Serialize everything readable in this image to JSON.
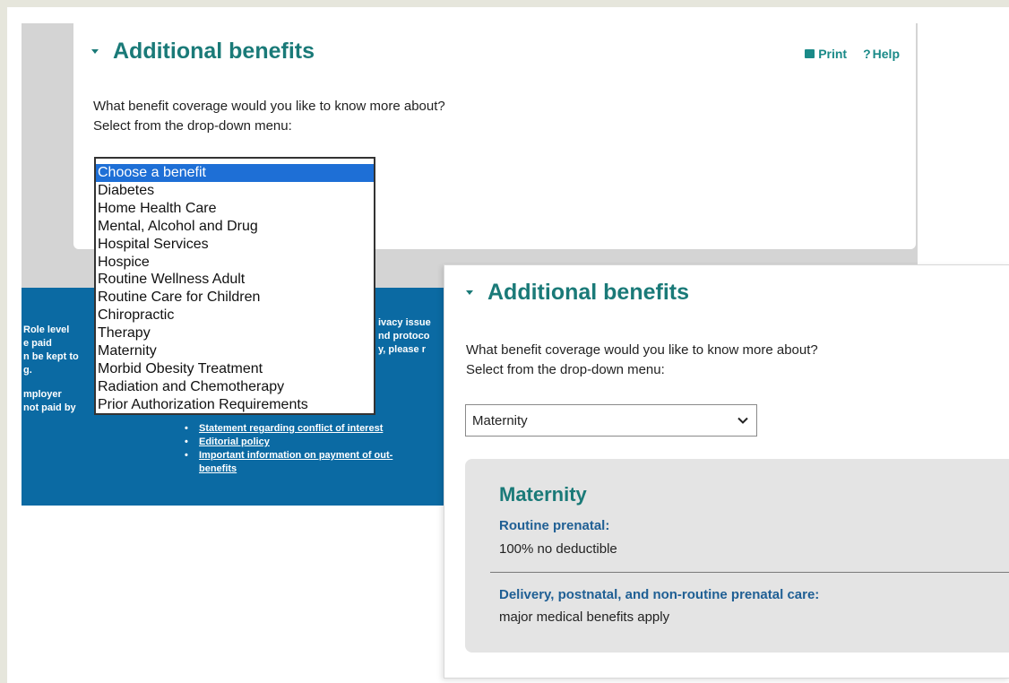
{
  "back": {
    "heading": "Additional benefits",
    "tools": {
      "print": "Print",
      "help": "Help"
    },
    "question": [
      "What benefit coverage would you like to know more about?",
      "Select from the drop-down menu:"
    ],
    "dropdown_options": [
      "Choose a benefit",
      "Diabetes",
      "Home Health Care",
      "Mental, Alcohol and Drug",
      "Hospital Services",
      "Hospice",
      "Routine Wellness Adult",
      "Routine Care for Children",
      "Chiropractic",
      "Therapy",
      "Maternity",
      "Morbid Obesity Treatment",
      "Radiation and Chemotherapy",
      "Prior Authorization Requirements"
    ],
    "selected_option": "Choose a benefit",
    "footer": {
      "left_text": [
        "Role level",
        "e paid",
        "n be kept to",
        "g.",
        "",
        "mployer",
        "not paid by"
      ],
      "mid_text": [
        "ivacy issue",
        "nd protoco",
        "y, please r"
      ],
      "links": [
        "Statement regarding conflict of interest",
        "Editorial policy",
        "Important information on payment of out-",
        "benefits"
      ]
    }
  },
  "front": {
    "heading": "Additional benefits",
    "question": [
      "What benefit coverage would you like to know more about?",
      "Select from the drop-down menu:"
    ],
    "select_value": "Maternity",
    "detail": {
      "title": "Maternity",
      "items": [
        {
          "label": "Routine prenatal:",
          "value": "100% no deductible"
        },
        {
          "label": "Delivery, postnatal, and non-routine prenatal care:",
          "value": "major medical benefits apply"
        }
      ]
    }
  },
  "colors": {
    "heading": "#1a7a78",
    "label": "#1f5f94",
    "footer": "#0b6aa3",
    "selection": "#1e6fd6"
  }
}
